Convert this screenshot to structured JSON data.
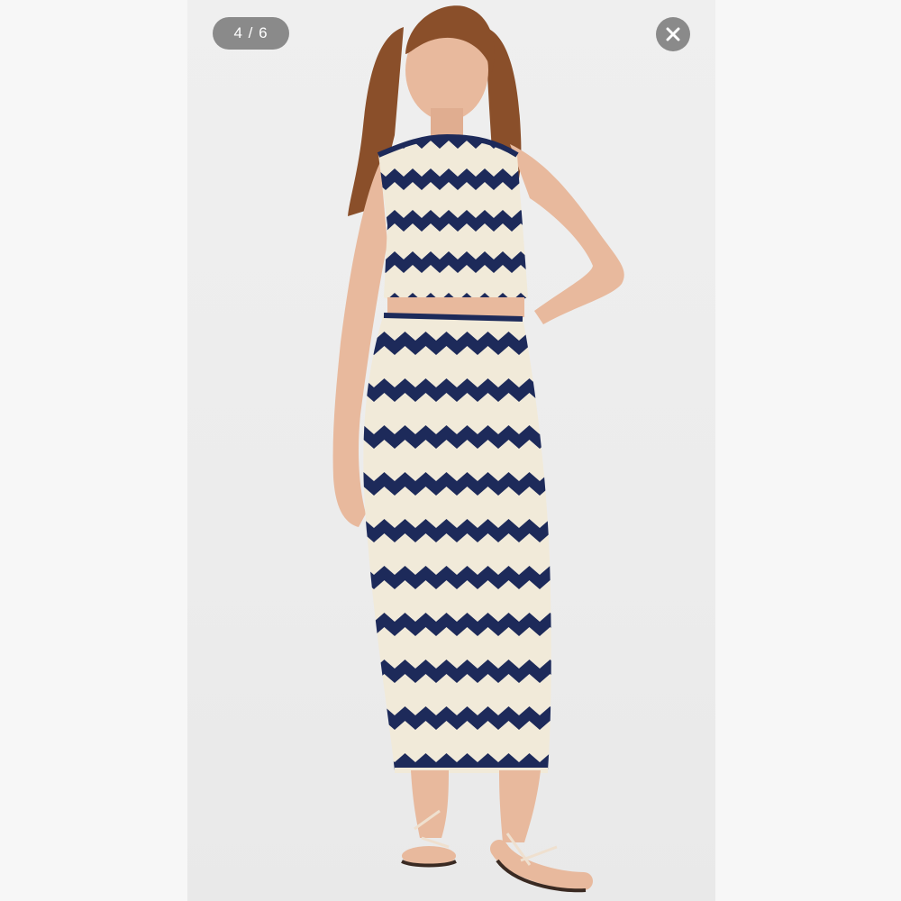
{
  "viewer": {
    "counter": "4 / 6",
    "current_index": 4,
    "total_images": 6,
    "close_icon": "close-icon"
  },
  "product": {
    "colors": {
      "navy": "#1d2a5a",
      "cream": "#f1ead9",
      "skin": "#e8b99d",
      "hair": "#8a4f2a",
      "background": "#efefef"
    }
  }
}
